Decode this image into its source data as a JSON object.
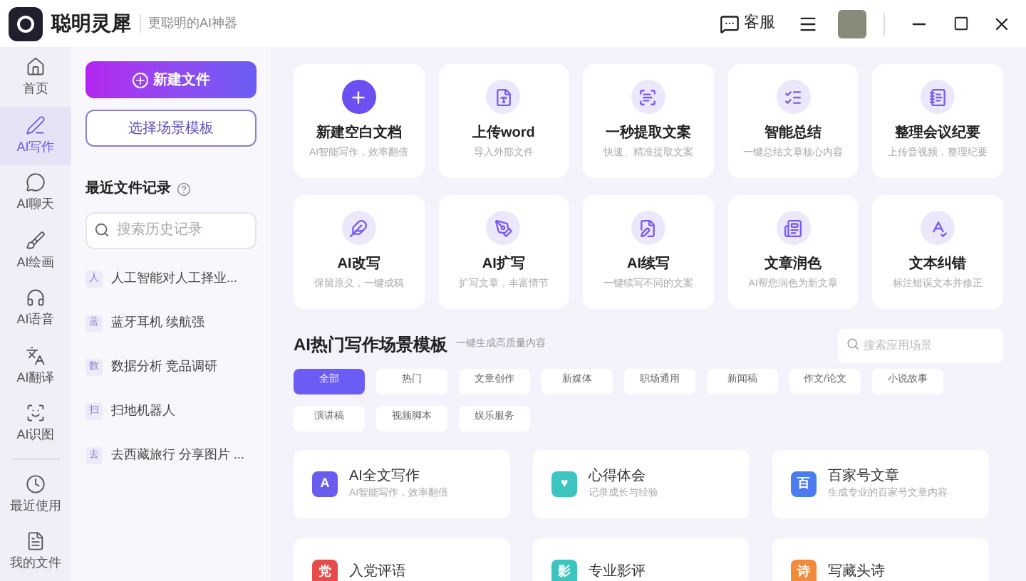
{
  "app": {
    "name": "聪明灵犀",
    "slogan": "更聪明的AI神器"
  },
  "topbar": {
    "support": "客服"
  },
  "nav": [
    {
      "label": "首页",
      "selected": false
    },
    {
      "label": "AI写作",
      "selected": true
    },
    {
      "label": "AI聊天",
      "selected": false
    },
    {
      "label": "AI绘画",
      "selected": false
    },
    {
      "label": "AI语音",
      "selected": false
    },
    {
      "label": "AI翻译",
      "selected": false
    },
    {
      "label": "AI识图",
      "selected": false
    },
    {
      "label": "最近使用",
      "selected": false
    },
    {
      "label": "我的文件",
      "selected": false
    }
  ],
  "left_panel": {
    "new_button": "新建文件",
    "template_button": "选择场景模板",
    "recent_title": "最近文件记录",
    "search_placeholder": "搜索历史记录",
    "recent": [
      {
        "badge": "人",
        "title": "人工智能对人工择业..."
      },
      {
        "badge": "蓝",
        "title": "蓝牙耳机 续航强"
      },
      {
        "badge": "数",
        "title": "数据分析 竞品调研"
      },
      {
        "badge": "扫",
        "title": "扫地机器人"
      },
      {
        "badge": "去",
        "title": "去西藏旅行 分享图片 ..."
      }
    ]
  },
  "tools": [
    {
      "title": "新建空白文档",
      "desc": "AI智能写作，效率翻倍"
    },
    {
      "title": "上传word",
      "desc": "导入外部文件"
    },
    {
      "title": "一秒提取文案",
      "desc": "快速、精准提取文案"
    },
    {
      "title": "智能总结",
      "desc": "一键总结文章核心内容"
    },
    {
      "title": "整理会议纪要",
      "desc": "上传音视频，整理纪要"
    },
    {
      "title": "AI改写",
      "desc": "保留原义，一键成稿"
    },
    {
      "title": "AI扩写",
      "desc": "扩写文章，丰富情节"
    },
    {
      "title": "AI续写",
      "desc": "一键续写不同的文案"
    },
    {
      "title": "文章润色",
      "desc": "AI帮您润色为新文章"
    },
    {
      "title": "文本纠错",
      "desc": "标注错误文本并修正"
    }
  ],
  "templates_section": {
    "title": "AI热门写作场景模板",
    "subtitle": "一键生成高质量内容",
    "search_placeholder": "搜索应用场景",
    "chips": [
      {
        "label": "全部",
        "selected": true
      },
      {
        "label": "热门",
        "selected": false
      },
      {
        "label": "文章创作",
        "selected": false
      },
      {
        "label": "新媒体",
        "selected": false
      },
      {
        "label": "职场通用",
        "selected": false
      },
      {
        "label": "新闻稿",
        "selected": false
      },
      {
        "label": "作文/论文",
        "selected": false
      },
      {
        "label": "小说故事",
        "selected": false
      },
      {
        "label": "演讲稿",
        "selected": false
      },
      {
        "label": "视频脚本",
        "selected": false
      },
      {
        "label": "娱乐服务",
        "selected": false
      }
    ],
    "items": [
      {
        "title": "AI全文写作",
        "desc": "AI智能写作，效率翻倍",
        "color": "#6b5cf0",
        "glyph": "A"
      },
      {
        "title": "心得体会",
        "desc": "记录成长与经验",
        "color": "#3cc4c0",
        "glyph": "♥"
      },
      {
        "title": "百家号文章",
        "desc": "生成专业的百家号文章内容",
        "color": "#4a7cf0",
        "glyph": "百"
      },
      {
        "title": "入党评语",
        "color": "#e54b4b",
        "glyph": "党"
      },
      {
        "title": "专业影评",
        "color": "#3cc4c0",
        "glyph": "影"
      },
      {
        "title": "写藏头诗",
        "color": "#f28a3c",
        "glyph": "诗"
      }
    ]
  }
}
